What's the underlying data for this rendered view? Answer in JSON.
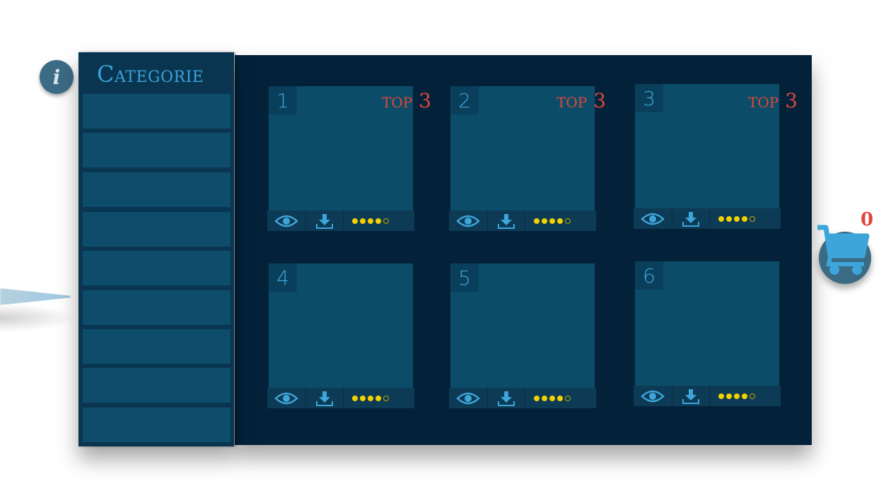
{
  "sidebar": {
    "title": "Categorie",
    "items": [
      "",
      "",
      "",
      "",
      "",
      "",
      "",
      "",
      ""
    ]
  },
  "cards": [
    {
      "number": "1",
      "badge": "top 3",
      "rating": 4,
      "rating_max": 5
    },
    {
      "number": "2",
      "badge": "top 3",
      "rating": 4,
      "rating_max": 5
    },
    {
      "number": "3",
      "badge": "top 3",
      "rating": 4,
      "rating_max": 5
    },
    {
      "number": "4",
      "badge": "",
      "rating": 4,
      "rating_max": 5
    },
    {
      "number": "5",
      "badge": "",
      "rating": 4,
      "rating_max": 5
    },
    {
      "number": "6",
      "badge": "",
      "rating": 4,
      "rating_max": 5
    }
  ],
  "cart": {
    "count": "0",
    "icon": "cart-icon"
  },
  "info": {
    "label": "i",
    "icon": "info-icon"
  },
  "colors": {
    "accent": "#3aa3d8",
    "badge": "#e0463a",
    "star": "#f1d100",
    "panel": "#03223a"
  }
}
